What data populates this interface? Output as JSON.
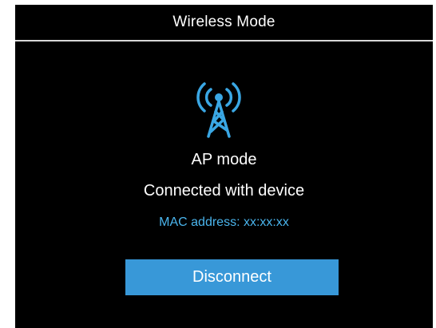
{
  "header": {
    "title": "Wireless Mode"
  },
  "status": {
    "icon": "antenna-tower-icon",
    "mode": "AP mode",
    "connection": "Connected with device",
    "mac": "MAC address: xx:xx:xx"
  },
  "actions": {
    "disconnect_label": "Disconnect"
  },
  "colors": {
    "background": "#000000",
    "text": "#ffffff",
    "accent_text": "#4ab4ec",
    "button": "#3898d8",
    "divider": "#d9d9d9"
  }
}
